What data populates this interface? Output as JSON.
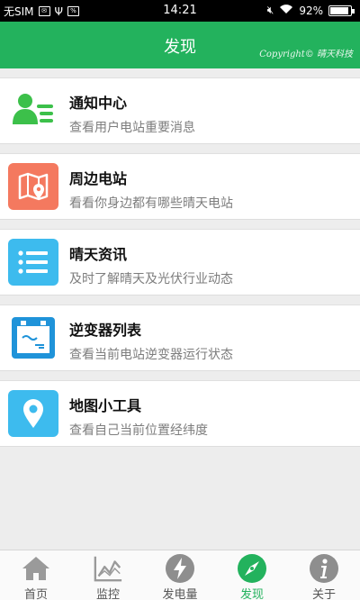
{
  "status_bar": {
    "carrier": "无SIM",
    "time": "14:21",
    "battery": "92%",
    "battery_level": 0.92
  },
  "header": {
    "title": "发现",
    "copyright": "Copyright© 晴天科技"
  },
  "items": [
    {
      "title": "通知中心",
      "subtitle": "查看用户电站重要消息",
      "icon": "user-notification-icon",
      "color": "#3cc04a"
    },
    {
      "title": "周边电站",
      "subtitle": "看看你身边都有哪些晴天电站",
      "icon": "map-pin-icon",
      "color": "#f4795f"
    },
    {
      "title": "晴天资讯",
      "subtitle": "及时了解晴天及光伏行业动态",
      "icon": "list-icon",
      "color": "#3dbbee"
    },
    {
      "title": "逆变器列表",
      "subtitle": "查看当前电站逆变器运行状态",
      "icon": "inverter-icon",
      "color": "#1f93d9"
    },
    {
      "title": "地图小工具",
      "subtitle": "查看自己当前位置经纬度",
      "icon": "location-icon",
      "color": "#3dbbee"
    }
  ],
  "tabs": [
    {
      "label": "首页",
      "icon": "home-icon"
    },
    {
      "label": "监控",
      "icon": "chart-icon"
    },
    {
      "label": "发电量",
      "icon": "lightning-icon"
    },
    {
      "label": "发现",
      "icon": "compass-icon",
      "active": true
    },
    {
      "label": "关于",
      "icon": "info-icon"
    }
  ],
  "colors": {
    "accent": "#23b25d",
    "background": "#ededed"
  }
}
